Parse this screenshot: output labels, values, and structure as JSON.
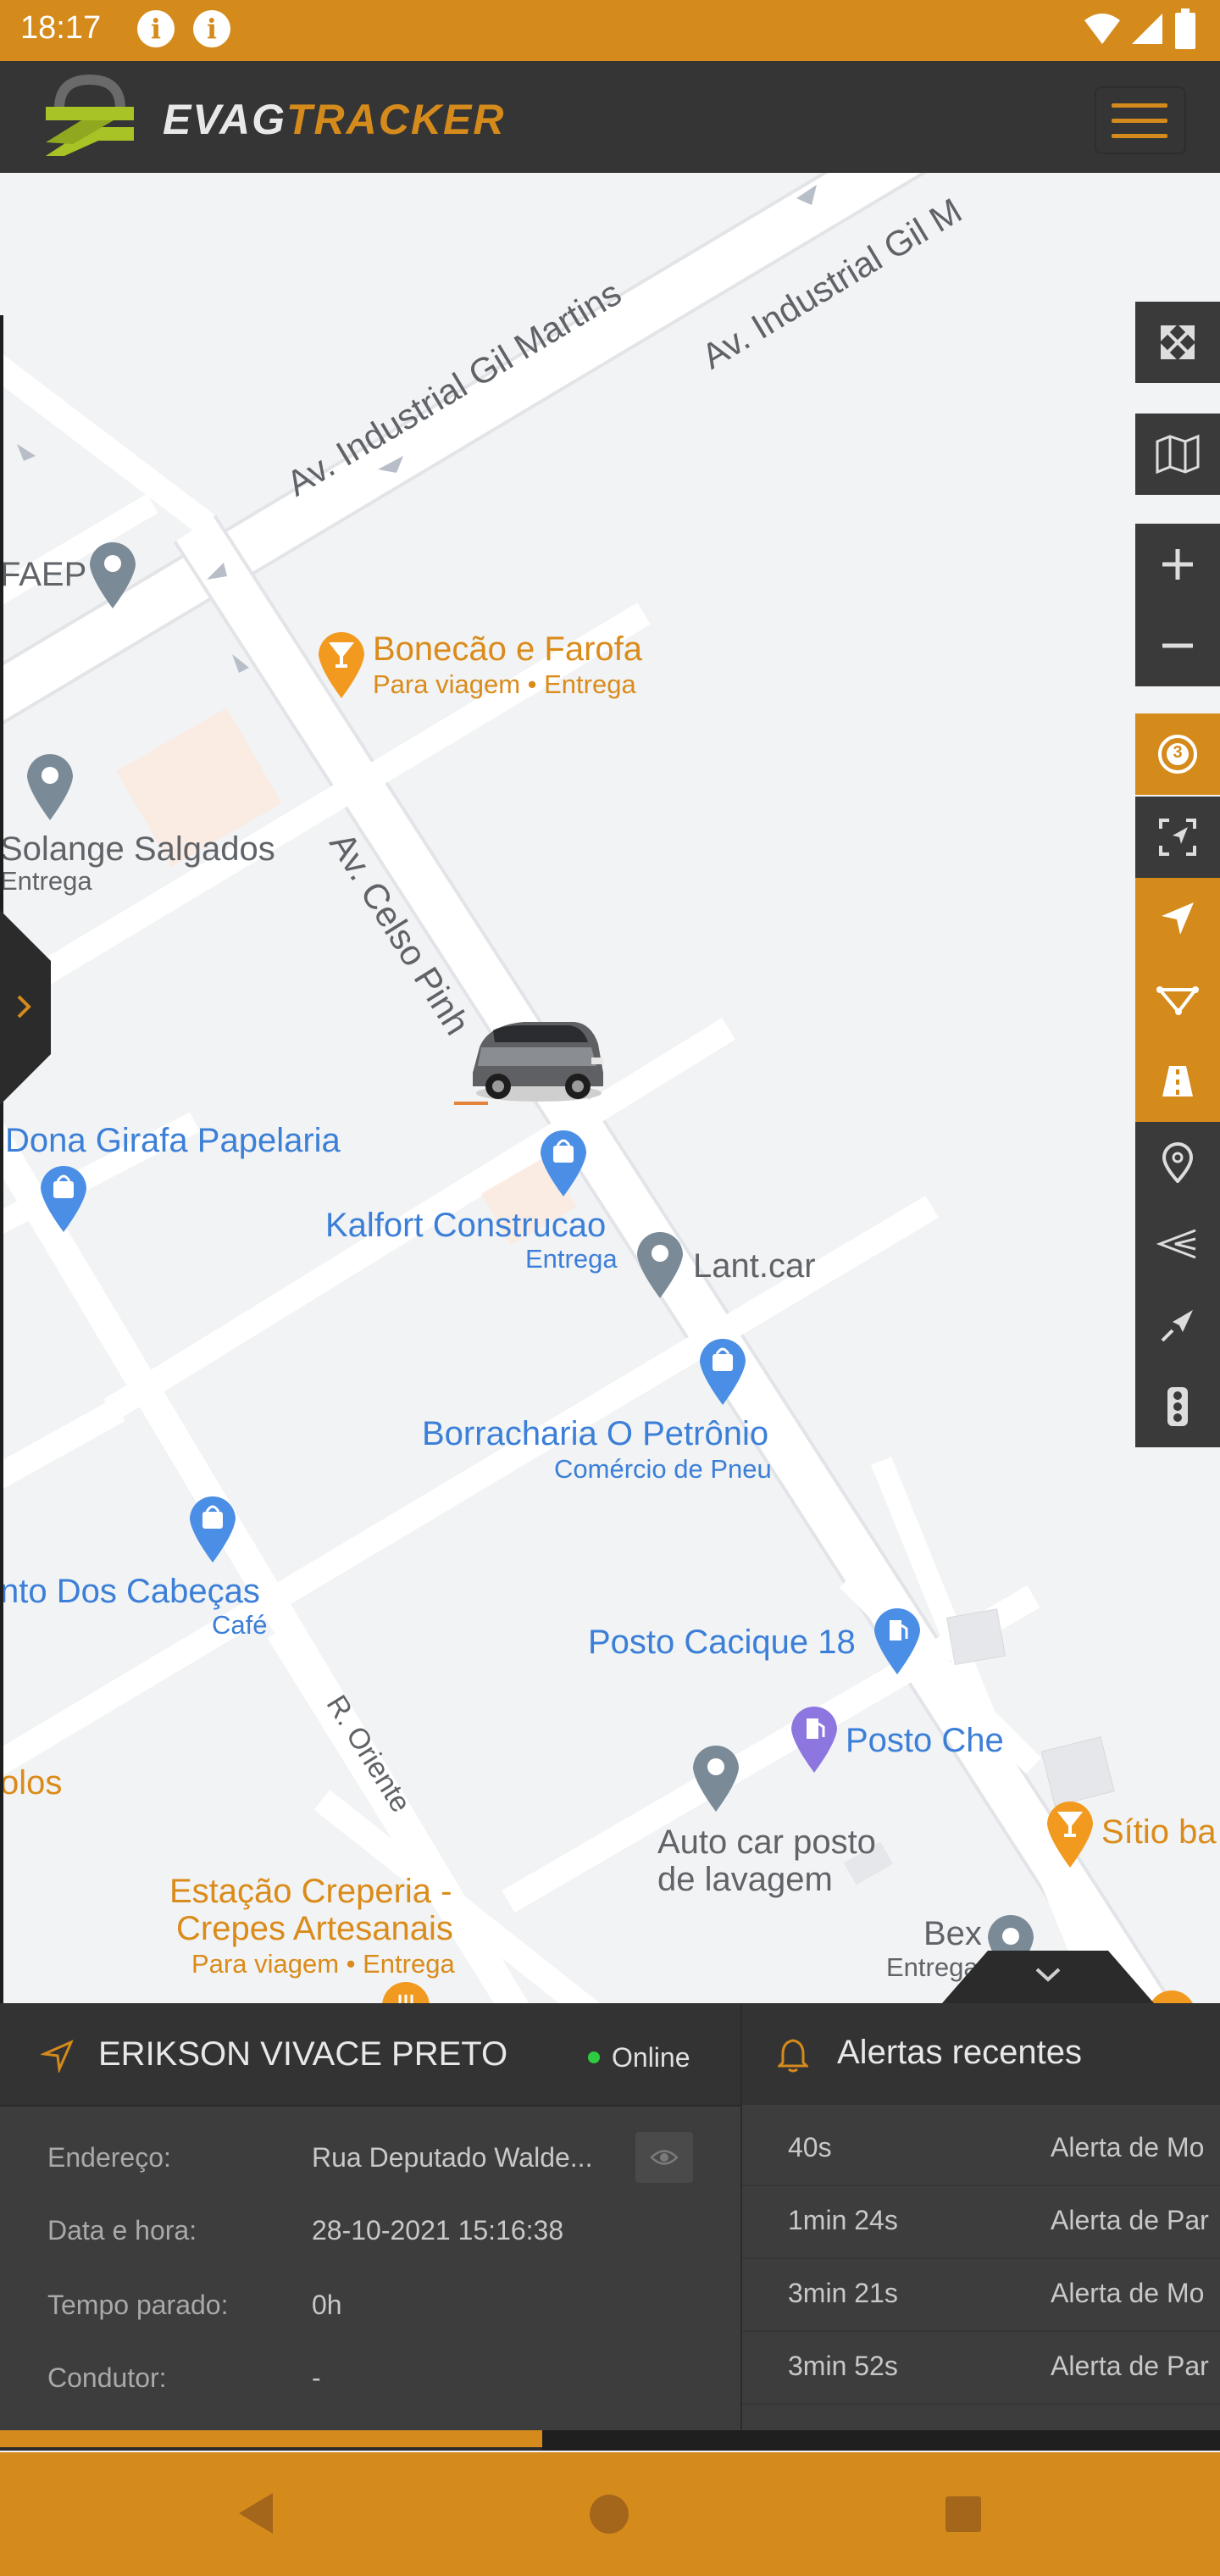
{
  "status_bar": {
    "time": "18:17",
    "icons": [
      "info-icon",
      "info-icon",
      "wifi-icon",
      "signal-icon",
      "battery-icon"
    ]
  },
  "header": {
    "logo_part1": "EVAG",
    "logo_part2": "TRACKER",
    "menu_icon": "hamburger-icon"
  },
  "map": {
    "roads": [
      "Av. Industrial Gil Martins",
      "Av. Industrial Gil M",
      "Av. Celso Pinh",
      "R. Oriente"
    ],
    "places": [
      {
        "name": "FAEP",
        "sub": ""
      },
      {
        "name": "Bonecão e Farofa",
        "sub": "Para viagem • Entrega"
      },
      {
        "name": "Solange Salgados",
        "sub": "Entrega"
      },
      {
        "name": "Dona Girafa Papelaria",
        "sub": ""
      },
      {
        "name": "Kalfort Construcao",
        "sub": "Entrega"
      },
      {
        "name": "Lant.car",
        "sub": ""
      },
      {
        "name": "Borracharia O Petrônio",
        "sub": "Comércio de Pneu"
      },
      {
        "name": "nto Dos Cabeças",
        "sub": "Café"
      },
      {
        "name": "Posto Cacique 18",
        "sub": ""
      },
      {
        "name": "Posto Che",
        "sub": ""
      },
      {
        "name": "olos",
        "sub": ""
      },
      {
        "name": "Auto car posto",
        "sub": "de lavagem"
      },
      {
        "name": "Sítio ba",
        "sub": ""
      },
      {
        "name": "Estação Creperia -",
        "sub": "Crepes Artesanais"
      },
      {
        "name": "Para viagem • Entrega",
        "sub": ""
      },
      {
        "name": "Bex",
        "sub": "Entrega"
      }
    ],
    "cluster_count": "3"
  },
  "vehicle": {
    "name": "ERIKSON VIVACE PRETO",
    "status": "Online",
    "rows": [
      {
        "label": "Endereço:",
        "value": "Rua Deputado Walde..."
      },
      {
        "label": "Data e hora:",
        "value": "28-10-2021 15:16:38"
      },
      {
        "label": "Tempo parado:",
        "value": "0h"
      },
      {
        "label": "Condutor:",
        "value": "-"
      }
    ]
  },
  "alerts": {
    "title": "Alertas recentes",
    "rows": [
      {
        "time": "40s",
        "message": "Alerta de Mo"
      },
      {
        "time": "1min 24s",
        "message": "Alerta de Par"
      },
      {
        "time": "3min 21s",
        "message": "Alerta de Mo"
      },
      {
        "time": "3min 52s",
        "message": "Alerta de Par"
      }
    ]
  },
  "colors": {
    "accent": "#d58a1c",
    "header": "#353535",
    "panel": "#3d3d3d",
    "online": "#2ecc40",
    "poi_blue": "#3c7fd8",
    "poi_orange": "#db8b1a"
  }
}
